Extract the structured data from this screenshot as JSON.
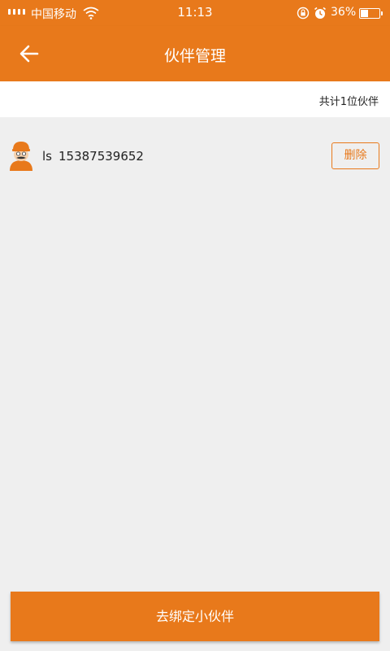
{
  "status_bar": {
    "carrier": "中国移动",
    "time": "11:13",
    "battery_percent": "36%",
    "battery_level": 0.36,
    "icons": [
      "signal-icon",
      "wifi-icon",
      "lock-rotation-icon",
      "alarm-icon",
      "battery-icon"
    ]
  },
  "header": {
    "title": "伙伴管理",
    "back_icon": "arrow-left-icon"
  },
  "summary": {
    "count_text": "共计1位伙伴"
  },
  "partners": [
    {
      "name": "ls",
      "phone": "15387539652",
      "delete_label": "删除",
      "avatar_icon": "worker-avatar-icon"
    }
  ],
  "footer": {
    "bind_label": "去绑定小伙伴"
  },
  "colors": {
    "accent": "#e8791b",
    "background": "#efefef",
    "surface": "#ffffff"
  }
}
